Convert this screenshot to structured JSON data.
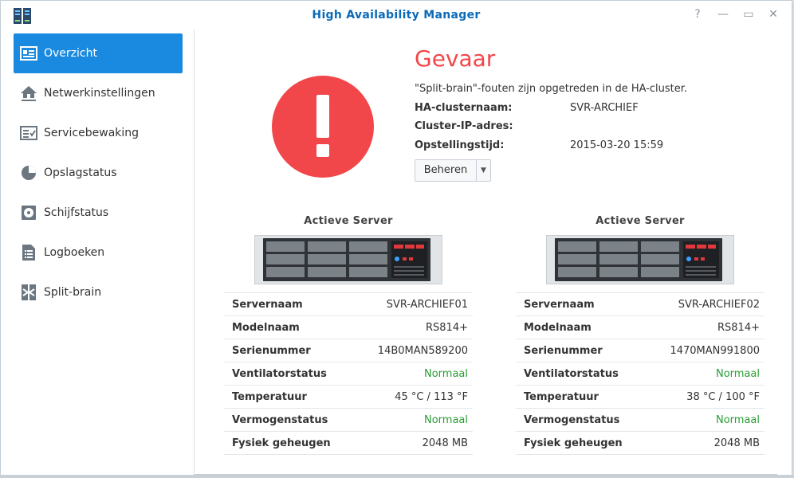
{
  "window": {
    "title": "High Availability Manager",
    "help_glyph": "?",
    "minimize_glyph": "—",
    "maximize_glyph": "▭",
    "close_glyph": "✕"
  },
  "sidebar": {
    "items": [
      {
        "label": "Overzicht",
        "icon": "overview-icon",
        "active": true
      },
      {
        "label": "Netwerkinstellingen",
        "icon": "network-home-icon",
        "active": false
      },
      {
        "label": "Servicebewaking",
        "icon": "service-list-icon",
        "active": false
      },
      {
        "label": "Opslagstatus",
        "icon": "pie-chart-icon",
        "active": false
      },
      {
        "label": "Schijfstatus",
        "icon": "disk-icon",
        "active": false
      },
      {
        "label": "Logboeken",
        "icon": "log-document-icon",
        "active": false
      },
      {
        "label": "Split-brain",
        "icon": "split-brain-icon",
        "active": false
      }
    ]
  },
  "status": {
    "title": "Gevaar",
    "message": "\"Split-brain\"-fouten zijn opgetreden in de HA-cluster.",
    "fields": [
      {
        "label": "HA-clusternaam:",
        "value": "SVR-ARCHIEF"
      },
      {
        "label": "Cluster-IP-adres:",
        "value": ""
      },
      {
        "label": "Opstellingstijd:",
        "value": "2015-03-20 15:59"
      }
    ],
    "manage_label": "Beheren",
    "color": "#f2474a"
  },
  "servers": [
    {
      "heading": "Actieve Server",
      "rows": [
        {
          "label": "Servernaam",
          "value": "SVR-ARCHIEF01",
          "ok": false
        },
        {
          "label": "Modelnaam",
          "value": "RS814+",
          "ok": false
        },
        {
          "label": "Serienummer",
          "value": "14B0MAN589200",
          "ok": false
        },
        {
          "label": "Ventilatorstatus",
          "value": "Normaal",
          "ok": true
        },
        {
          "label": "Temperatuur",
          "value": "45 °C / 113 °F",
          "ok": false
        },
        {
          "label": "Vermogenstatus",
          "value": "Normaal",
          "ok": true
        },
        {
          "label": "Fysiek geheugen",
          "value": "2048 MB",
          "ok": false
        }
      ]
    },
    {
      "heading": "Actieve Server",
      "rows": [
        {
          "label": "Servernaam",
          "value": "SVR-ARCHIEF02",
          "ok": false
        },
        {
          "label": "Modelnaam",
          "value": "RS814+",
          "ok": false
        },
        {
          "label": "Serienummer",
          "value": "1470MAN991800",
          "ok": false
        },
        {
          "label": "Ventilatorstatus",
          "value": "Normaal",
          "ok": true
        },
        {
          "label": "Temperatuur",
          "value": "38 °C / 100 °F",
          "ok": false
        },
        {
          "label": "Vermogenstatus",
          "value": "Normaal",
          "ok": true
        },
        {
          "label": "Fysiek geheugen",
          "value": "2048 MB",
          "ok": false
        }
      ]
    }
  ],
  "colors": {
    "accent": "#1a8ae0",
    "title": "#0a6ab8",
    "ok": "#2a9d33"
  }
}
